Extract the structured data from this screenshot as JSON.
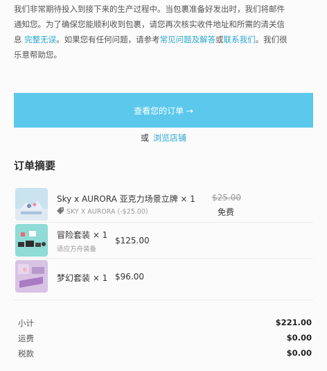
{
  "intro": {
    "line1": "我们非常期待投入到接下来的生产过程中。当包裹准备好发出时，我们将邮件",
    "line2": "通知您。为了确保您能顺利收到包裹，请您再次核实收件地址和所需的清关信",
    "line3_pre": "息",
    "line3_link1": "完整无误",
    "line3_mid": "。如果您有任何问题，请参考",
    "line3_link2": "常见问题及解答",
    "line3_or": "或",
    "line3_link3": "联系我们",
    "line3_post": "。我们很",
    "line4": "乐意帮助您。"
  },
  "view_order_button": "查看您的订单 →",
  "or_text": "或",
  "browse_store_link": "浏览店铺",
  "summary_title": "订单摘要",
  "items": [
    {
      "name": "Sky x AURORA 亚克力场景立牌 × 1",
      "original_price": "$25.00",
      "price": "免费",
      "discount": "SKY X AURORA (-$25.00)"
    },
    {
      "name": "冒险套装 × 1",
      "note": "适应方舟装备",
      "price": "$125.00"
    },
    {
      "name": "梦幻套装 × 1",
      "price": "$96.00"
    }
  ],
  "totals": {
    "subtotal_label": "小计",
    "subtotal_value": "$221.00",
    "shipping_label": "运费",
    "shipping_value": "$0.00",
    "tax_label": "税款",
    "tax_value": "$0.00"
  },
  "colors": {
    "accent": "#5cc8ec",
    "link": "#2aa7cf"
  }
}
